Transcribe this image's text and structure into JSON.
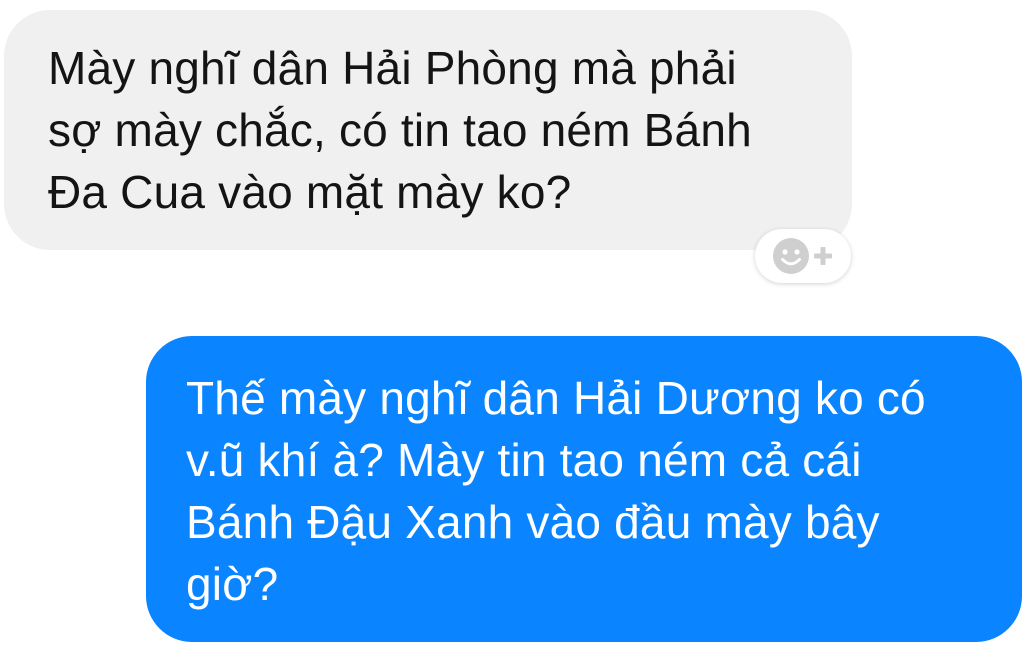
{
  "conversation": {
    "messages": [
      {
        "direction": "incoming",
        "lines": [
          "Mày nghĩ dân Hải Phòng mà phải",
          "sợ mày chắc, có tin tao ném Bánh",
          "Đa Cua vào mặt mày ko?"
        ]
      },
      {
        "direction": "outgoing",
        "lines": [
          "Thế mày nghĩ dân Hải Dương ko có",
          "v.ũ khí à? Mày tin tao ném cả cái",
          "Bánh Đậu Xanh vào đầu mày bây",
          "giờ?"
        ]
      }
    ],
    "reaction_button": {
      "icons": [
        "smiley-face-icon",
        "plus-icon"
      ]
    }
  },
  "colors": {
    "incoming_bubble": "#f0f0f0",
    "outgoing_bubble": "#0a84ff",
    "incoming_text": "#141414",
    "outgoing_text": "#ffffff",
    "reaction_icon": "#c8c8c8"
  }
}
